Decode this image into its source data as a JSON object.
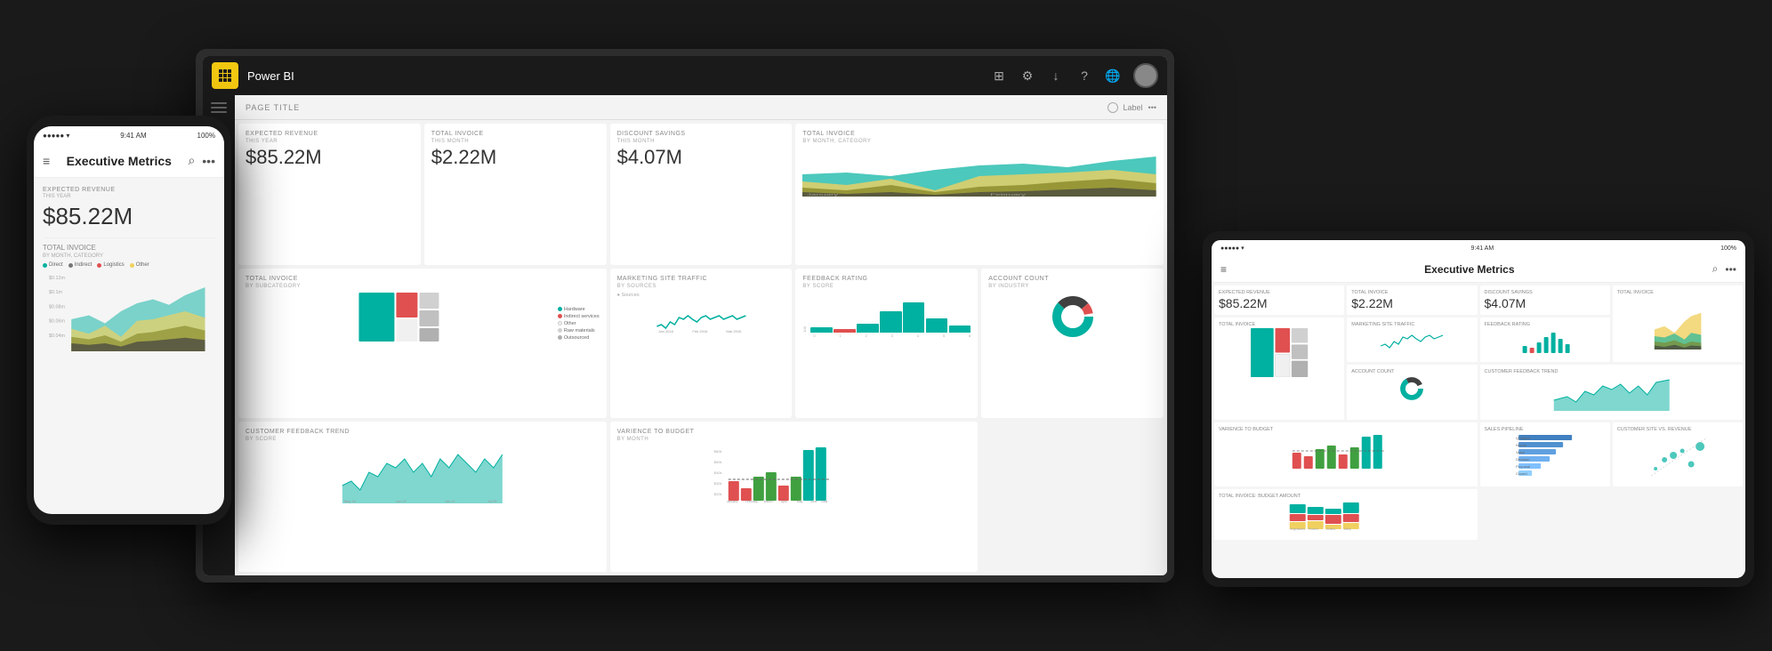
{
  "app": {
    "title": "Power BI",
    "page_label": "PAGE TITLE",
    "label_btn": "Label"
  },
  "top_icons": [
    "grid-icon",
    "settings-icon",
    "download-icon",
    "help-icon",
    "globe-icon",
    "avatar-icon"
  ],
  "phone_left": {
    "status_time": "9:41 AM",
    "status_signal": "●●●●●",
    "status_wifi": "▾",
    "status_battery": "100%",
    "nav_title": "Executive Metrics",
    "menu_icon": "≡",
    "search_icon": "⌕",
    "more_icon": "•••",
    "kpi1_label": "Expected Revenue",
    "kpi1_sub": "THIS YEAR",
    "kpi1_value": "$85.22M",
    "section2_title": "Total Invoice",
    "section2_sub": "BY MONTH, CATEGORY",
    "legend": [
      {
        "label": "Direct",
        "color": "#00b0a0"
      },
      {
        "label": "Indirect",
        "color": "#f0d060"
      },
      {
        "label": "Logistics",
        "color": "#e05050"
      },
      {
        "label": "Other",
        "color": "#aaa"
      }
    ],
    "y_labels": [
      "$0.12m",
      "$0.1m",
      "$0.08m",
      "$0.06m",
      "$0.04m"
    ]
  },
  "monitor": {
    "kpi_cards": [
      {
        "title": "Expected Revenue",
        "sub": "THIS YEAR",
        "value": "$85.22M"
      },
      {
        "title": "Total Invoice",
        "sub": "THIS MONTH",
        "value": "$2.22M"
      },
      {
        "title": "Discount Savings",
        "sub": "THIS MONTH",
        "value": "$4.07M"
      }
    ],
    "chart_cards": [
      {
        "title": "Marketing Site Traffic",
        "sub": "BY SOURCES"
      },
      {
        "title": "Feedback Rating",
        "sub": "BY SCORE"
      },
      {
        "title": "Account Count",
        "sub": "BY INDUSTRY"
      },
      {
        "title": "Total Invoice",
        "sub": "BY MONTH, CATEGORY"
      },
      {
        "title": "Total Invoice",
        "sub": "BY SUBCATEGORY"
      },
      {
        "title": "Customer Feedback Trend",
        "sub": "BY SCORE"
      },
      {
        "title": "Varience to Budget",
        "sub": "BY MONTH"
      }
    ]
  },
  "tablet_right": {
    "status_time": "9:41 AM",
    "status_signal": "●●●●●",
    "status_wifi": "▾",
    "status_battery": "100%",
    "nav_title": "Executive Metrics",
    "kpi_row": [
      {
        "label": "Expected Revenue",
        "value": "$85.22M"
      },
      {
        "label": "Total Invoice",
        "value": "$2.22M"
      },
      {
        "label": "Discount Savings",
        "value": "$4.07M"
      }
    ]
  }
}
